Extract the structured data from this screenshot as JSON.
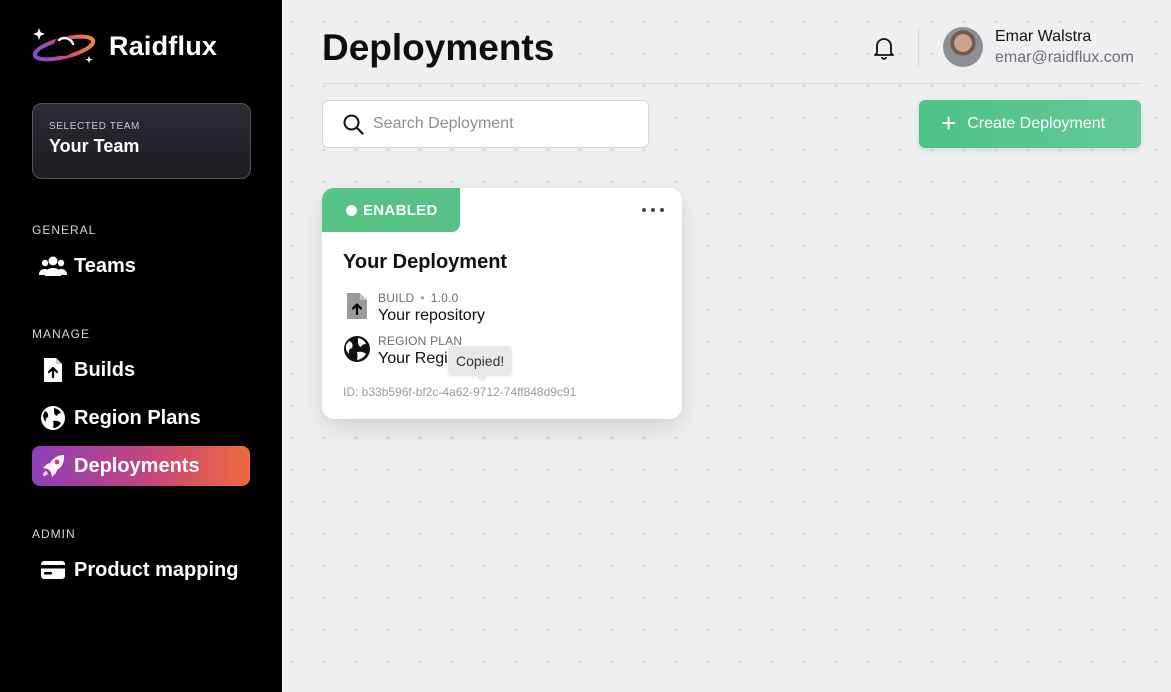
{
  "brand": {
    "name": "Raidflux"
  },
  "team": {
    "caption": "SELECTED TEAM",
    "name": "Your Team"
  },
  "sidebar": {
    "sections": [
      {
        "title": "GENERAL",
        "items": [
          {
            "label": "Teams",
            "icon": "users-icon",
            "active": false
          }
        ]
      },
      {
        "title": "MANAGE",
        "items": [
          {
            "label": "Builds",
            "icon": "file-upload-icon",
            "active": false
          },
          {
            "label": "Region Plans",
            "icon": "globe-icon",
            "active": false
          },
          {
            "label": "Deployments",
            "icon": "rocket-icon",
            "active": true
          }
        ]
      },
      {
        "title": "ADMIN",
        "items": [
          {
            "label": "Product mapping",
            "icon": "credit-card-icon",
            "active": false
          }
        ]
      }
    ]
  },
  "header": {
    "title": "Deployments",
    "user": {
      "name": "Emar Walstra",
      "email": "emar@raidflux.com"
    }
  },
  "toolbar": {
    "search_placeholder": "Search Deployment",
    "create_label": "Create Deployment"
  },
  "deployment": {
    "status": "ENABLED",
    "title": "Your Deployment",
    "build": {
      "caption": "BUILD",
      "version": "1.0.0",
      "value": "Your repository"
    },
    "region": {
      "caption": "REGION PLAN",
      "value": "Your Regi"
    },
    "id_text": "ID: b33b596f-bf2c-4a62-9712-74ff848d9c91",
    "tooltip": "Copied!"
  },
  "colors": {
    "sidebar_bg": "#000000",
    "accent_green": "#56c286",
    "active_gradient": [
      "#8d3fb8",
      "#c6457a",
      "#ef6a3e"
    ],
    "page_bg": "#efeff1"
  }
}
